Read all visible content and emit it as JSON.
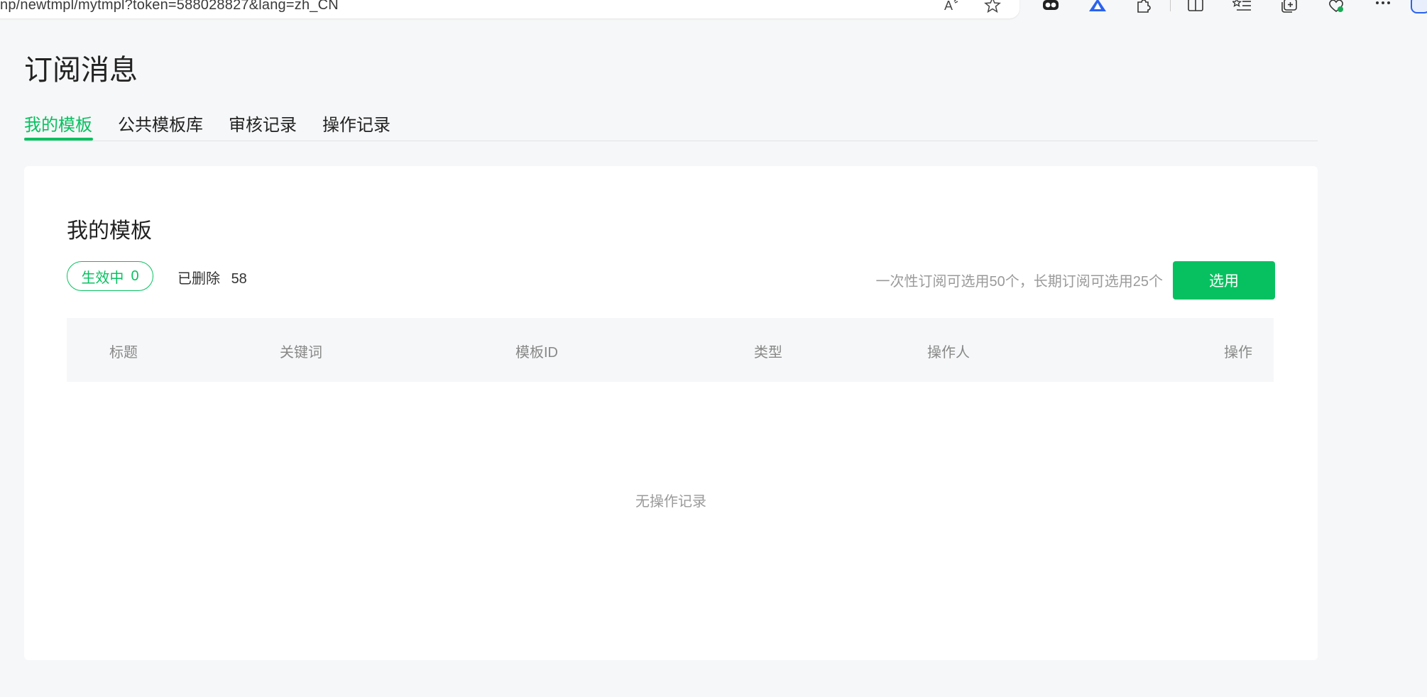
{
  "browser": {
    "url": "np/newtmpl/mytmpl?token=588028827&lang=zh_CN"
  },
  "page": {
    "title": "订阅消息"
  },
  "tabs": [
    {
      "label": "我的模板",
      "active": true
    },
    {
      "label": "公共模板库",
      "active": false
    },
    {
      "label": "审核记录",
      "active": false
    },
    {
      "label": "操作记录",
      "active": false
    }
  ],
  "card": {
    "title": "我的模板",
    "filters": {
      "active": {
        "label": "生效中",
        "count": "0"
      },
      "deleted": {
        "label": "已删除",
        "count": "58"
      }
    },
    "hint": "一次性订阅可选用50个，长期订阅可选用25个",
    "select_label": "选用",
    "columns": [
      "标题",
      "关键词",
      "模板ID",
      "类型",
      "操作人",
      "操作"
    ],
    "empty_text": "无操作记录"
  },
  "colors": {
    "accent": "#07c160",
    "background": "#f6f7f8"
  }
}
